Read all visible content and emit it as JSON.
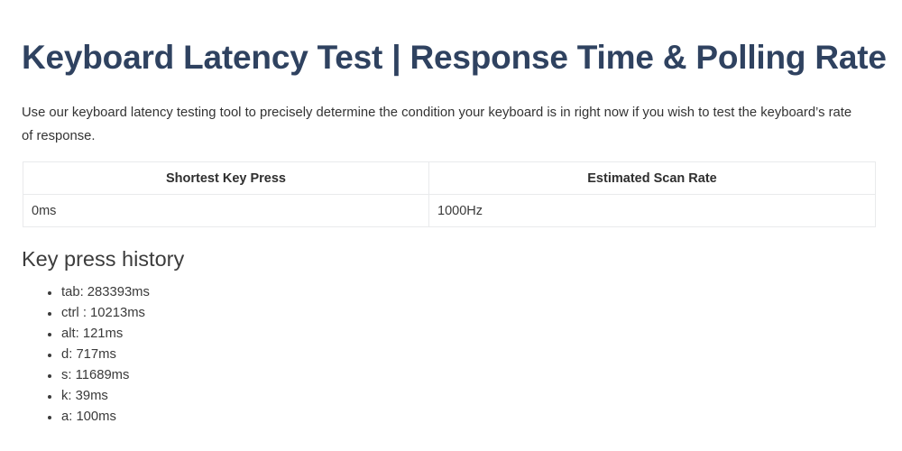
{
  "page": {
    "title": "Keyboard Latency Test | Response Time & Polling Rate",
    "intro": "Use our keyboard latency testing tool to precisely determine the condition your keyboard is in right now if you wish to test the keyboard’s rate of response.",
    "title_color": "#2f4260",
    "body_color": "#333333",
    "border_color": "#e9eaec"
  },
  "results_table": {
    "headers": [
      "Shortest Key Press",
      "Estimated Scan Rate"
    ],
    "rows": [
      [
        "0ms",
        "1000Hz"
      ]
    ]
  },
  "history": {
    "heading": "Key press history",
    "items": [
      "tab: 283393ms",
      "ctrl : 10213ms",
      "alt: 121ms",
      "d: 717ms",
      "s: 11689ms",
      "k: 39ms",
      "a: 100ms"
    ]
  }
}
